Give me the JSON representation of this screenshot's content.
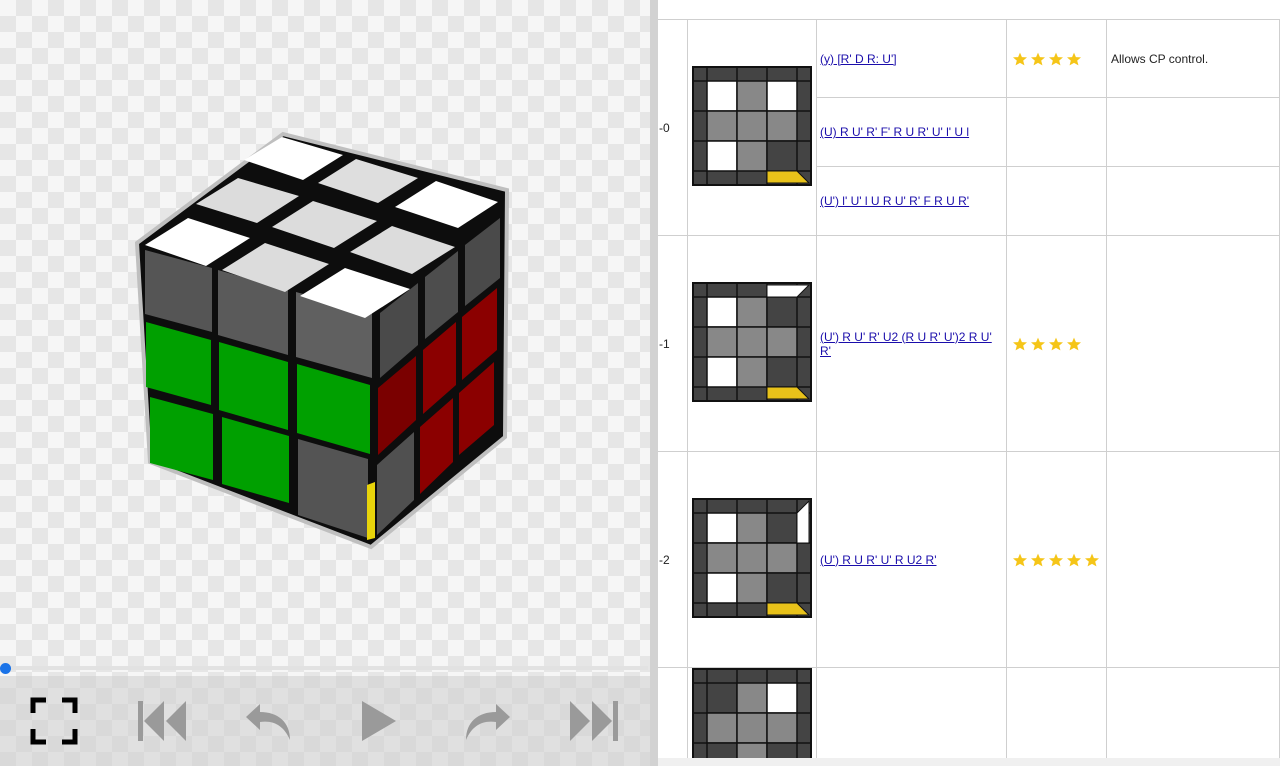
{
  "viewer": {
    "cube_colors": {
      "top": "#ffffff",
      "top_center_cross": "#dcdcdc",
      "gray_sticker": "#5a5a5a",
      "green": "#00a000",
      "red": "#8b0000",
      "yellow": "#e8d40a",
      "blue": "#0a0a8a"
    },
    "progress": 0,
    "controls": [
      {
        "name": "fullscreen-icon"
      },
      {
        "name": "skip-to-start-icon"
      },
      {
        "name": "step-back-icon"
      },
      {
        "name": "play-icon"
      },
      {
        "name": "step-forward-icon"
      },
      {
        "name": "skip-to-end-icon"
      }
    ]
  },
  "table": {
    "rows": [
      {
        "case": "-0",
        "algs": [
          {
            "text": "(y) [R' D R: U']",
            "rating": 4,
            "note": "Allows CP control."
          },
          {
            "text": "(U) R U' R' F' R U R' U' l' U l",
            "rating": 0,
            "note": ""
          },
          {
            "text": "(U') l' U' l U R U' R' F R U R'",
            "rating": 0,
            "note": ""
          }
        ]
      },
      {
        "case": "-1",
        "algs": [
          {
            "text": "(U') R U' R' U2 (R U R' U')2 R U' R'",
            "rating": 4,
            "note": ""
          }
        ]
      },
      {
        "case": "-2",
        "algs": [
          {
            "text": "(U') R U R' U' R U2 R'",
            "rating": 5,
            "note": ""
          }
        ]
      },
      {
        "case": "",
        "algs": [
          {
            "text": "",
            "rating": 0,
            "note": ""
          }
        ]
      }
    ]
  },
  "colors": {
    "link": "#1a0dab",
    "star": "#f5c518",
    "accent": "#1a73e8",
    "diagram_dark": "#444444",
    "diagram_mid": "#888888",
    "diagram_yellow": "#e8c21a"
  }
}
